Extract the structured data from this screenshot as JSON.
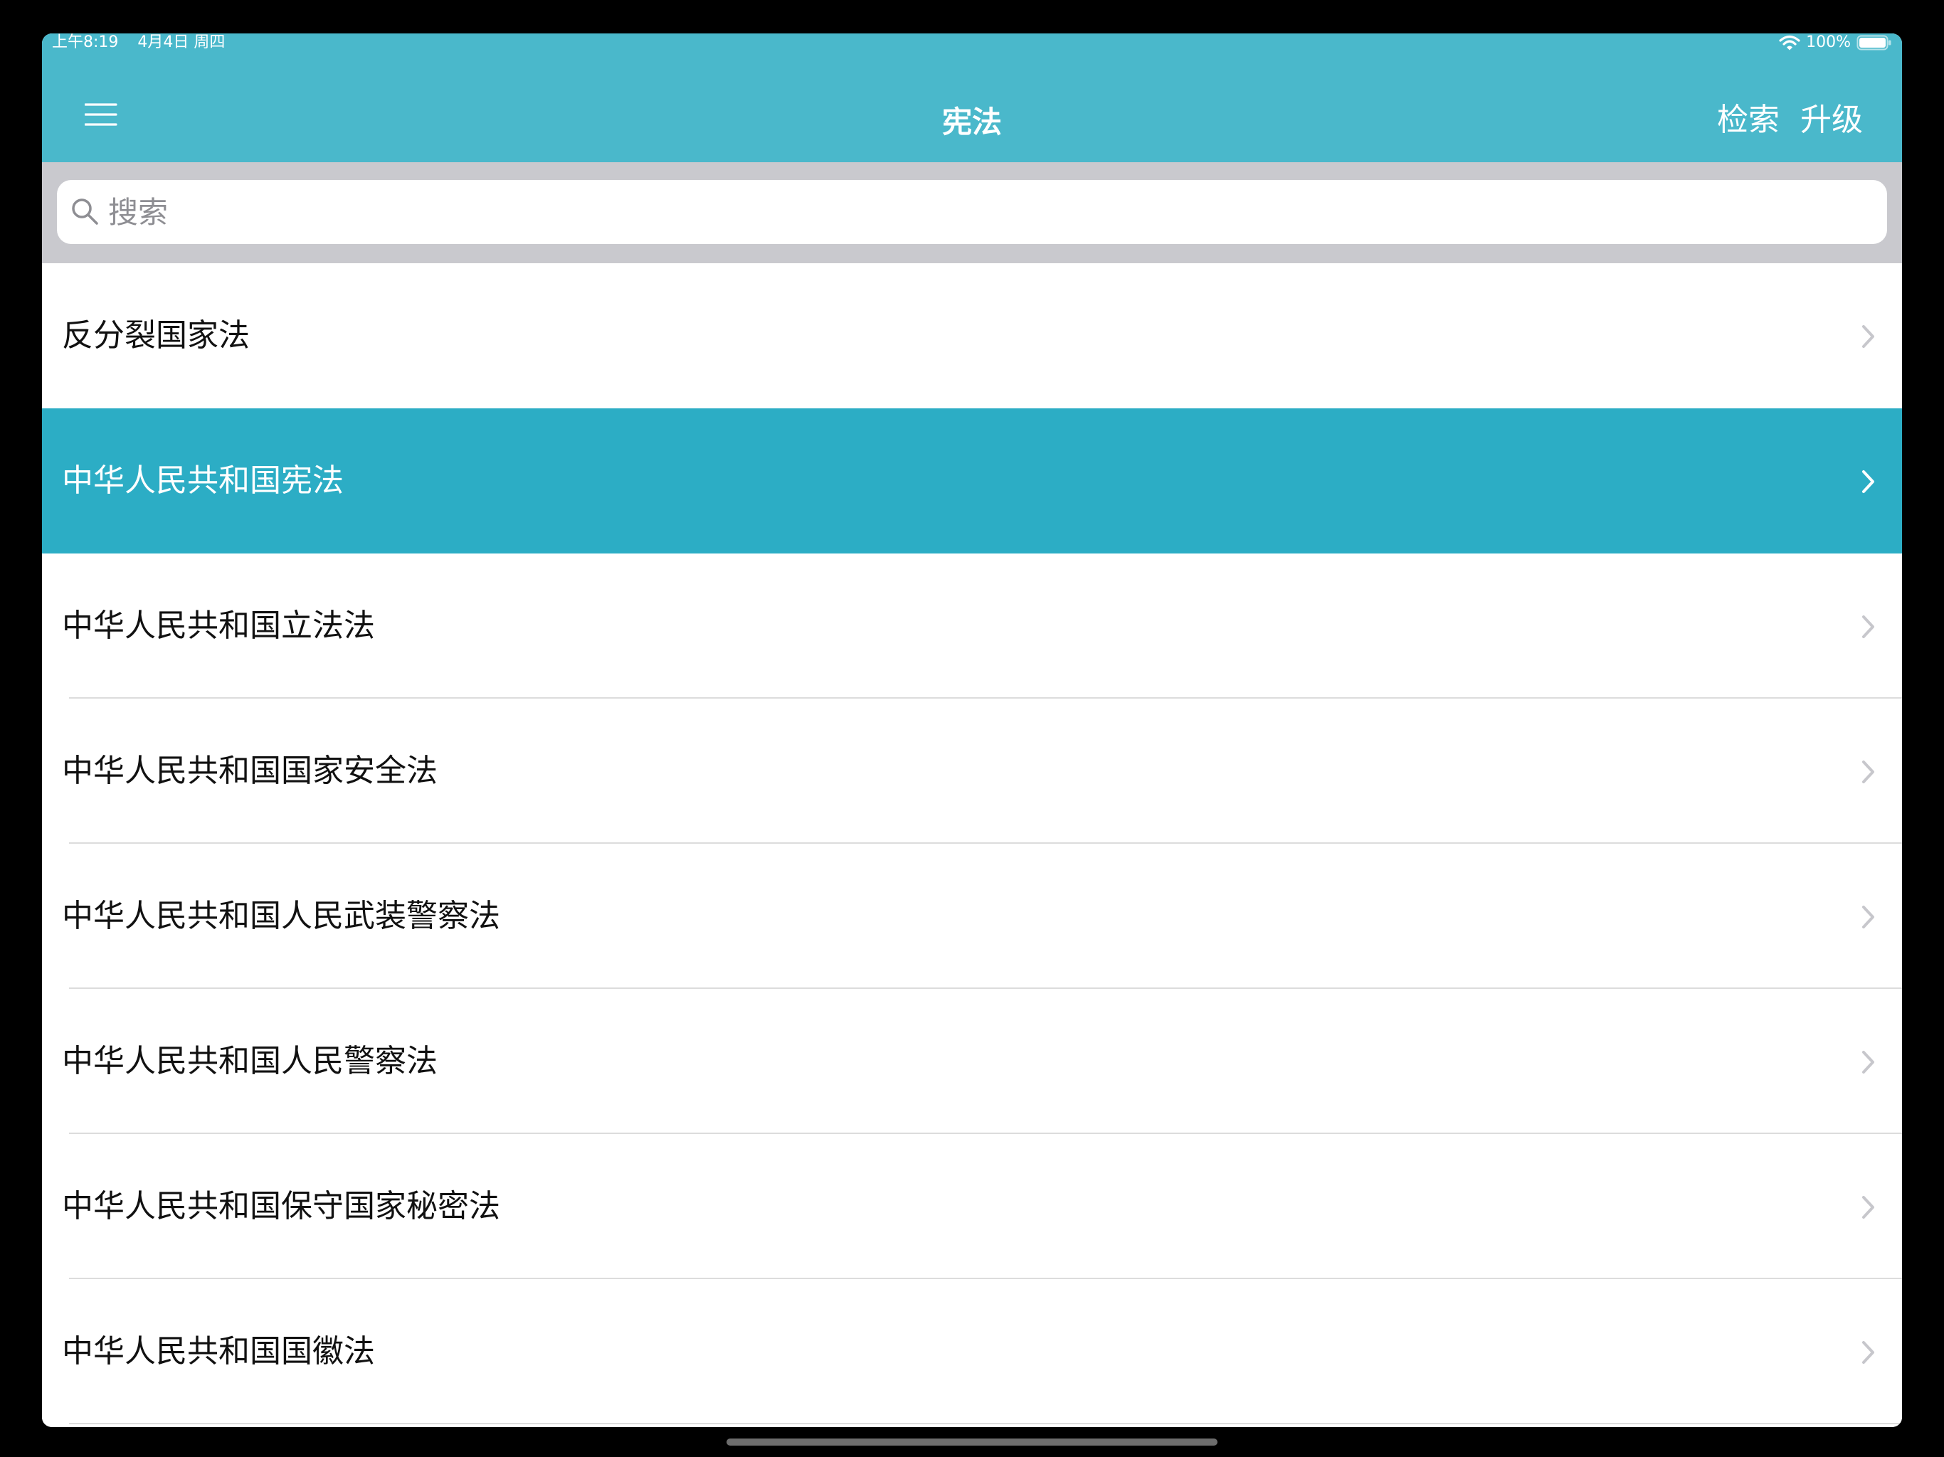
{
  "status_bar": {
    "time": "上午8:19",
    "date": "4月4日 周四",
    "battery": "100%",
    "wifi_icon": "wifi-icon",
    "battery_icon": "battery-icon"
  },
  "nav": {
    "title": "宪法",
    "search_label": "检索",
    "upgrade_label": "升级",
    "menu_icon": "menu-icon"
  },
  "search": {
    "placeholder": "搜索",
    "value": "",
    "icon": "search-icon"
  },
  "laws": [
    {
      "label": "反分裂国家法",
      "selected": false
    },
    {
      "label": "中华人民共和国宪法",
      "selected": true
    },
    {
      "label": "中华人民共和国立法法",
      "selected": false
    },
    {
      "label": "中华人民共和国国家安全法",
      "selected": false
    },
    {
      "label": "中华人民共和国人民武装警察法",
      "selected": false
    },
    {
      "label": "中华人民共和国人民警察法",
      "selected": false
    },
    {
      "label": "中华人民共和国保守国家秘密法",
      "selected": false
    },
    {
      "label": "中华人民共和国国徽法",
      "selected": false
    }
  ],
  "colors": {
    "header": "#4ab8cb",
    "selected_row": "#2cadc5",
    "search_region": "#c9c9ce",
    "divider": "#dcdcdc"
  }
}
